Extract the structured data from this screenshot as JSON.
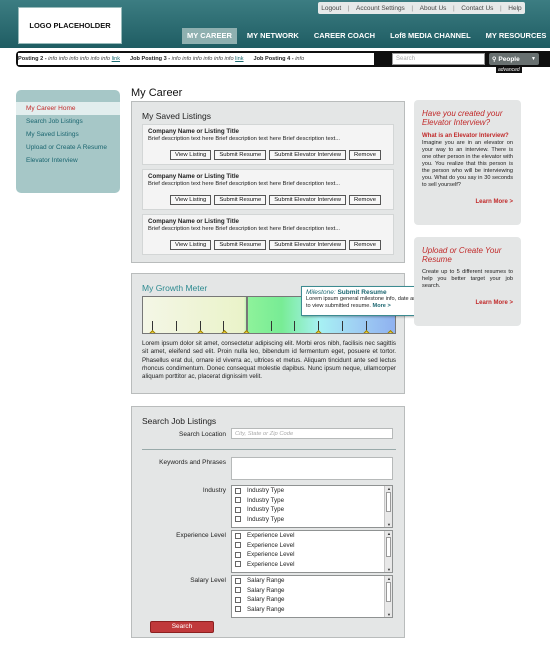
{
  "header": {
    "logo": "LOGO PLACEHOLDER",
    "util_links": [
      "Logout",
      "Account Settings",
      "About Us",
      "Contact Us",
      "Help"
    ],
    "nav": [
      "MY CAREER",
      "MY NETWORK",
      "CAREER COACH",
      "Lof8 MEDIA CHANNEL",
      "MY RESOURCES"
    ]
  },
  "ticker": {
    "p1_title": "Posting 2 - ",
    "p1_text": "info info info info info info ",
    "p1_link": "link",
    "p2_title": "Job Posting 3 - ",
    "p2_text": "info info info info info info ",
    "p2_link": "link",
    "p3_title": "Job Posting 4 - ",
    "p3_text": "info",
    "search_placeholder": "Search",
    "people_label": "People",
    "advanced": "advanced"
  },
  "sidebar": [
    "My Career Home",
    "Search Job Listings",
    "My Saved Listings",
    "Upload or Create A Resume",
    "Elevator Interview"
  ],
  "page_title": "My Career",
  "saved": {
    "title": "My Saved Listings",
    "listing_title": "Company Name or Listing Title",
    "listing_desc": "Brief description text here Brief description text here Brief description text...",
    "buttons": [
      "View Listing",
      "Submit Resume",
      "Submit Elevator Interview",
      "Remove"
    ]
  },
  "growth": {
    "title": "My Growth Meter",
    "milestone_label": "Milestone:",
    "milestone_value": "Submit Resume",
    "tooltip_text": "Lorem ipsum general milestone info, date and a link to view submitted resume.",
    "more": "More >",
    "body": "Lorem ipsum dolor sit amet, consectetur adipiscing elit. Morbi eros nibh, facilisis nec sagittis sit amet, eleifend sed elit. Proin nulla leo, bibendum id fermentum eget, posuere et tortor. Phasellus erat dui, ornare id viverra ac, ultrices et metus. Aliquam tincidunt ante sed lectus rhoncus condimentum. Donec consequat molestie dapibus. Nunc ipsum neque, ullamcorper aliquam porttitor ac, placerat dignissim velit."
  },
  "search": {
    "title": "Search Job Listings",
    "location_label": "Search Location",
    "location_placeholder": "City, State or Zip Code",
    "keywords_label": "Keywords and Phrases",
    "industry_label": "Industry",
    "industry_option": "Industry Type",
    "experience_label": "Experience Level",
    "experience_option": "Experience Level",
    "salary_label": "Salary Level",
    "salary_option": "Salary Range",
    "search_button": "Search"
  },
  "promo1": {
    "heading": "Have you created your Elevator Interview?",
    "sub": "What is an Elevator Interview?",
    "body": "Imagine you are in an elevator on your way to an interview. There is one other person in the elevator with you. You realize that this person is the person who will be interviewing you. What do you say in 30 seconds to sell yourself?",
    "learn_more": "Learn More >"
  },
  "promo2": {
    "heading": "Upload or Create Your Resume",
    "body": "Create up to 5 different resumes to help you better target your job search.",
    "learn_more": "Learn More >"
  }
}
